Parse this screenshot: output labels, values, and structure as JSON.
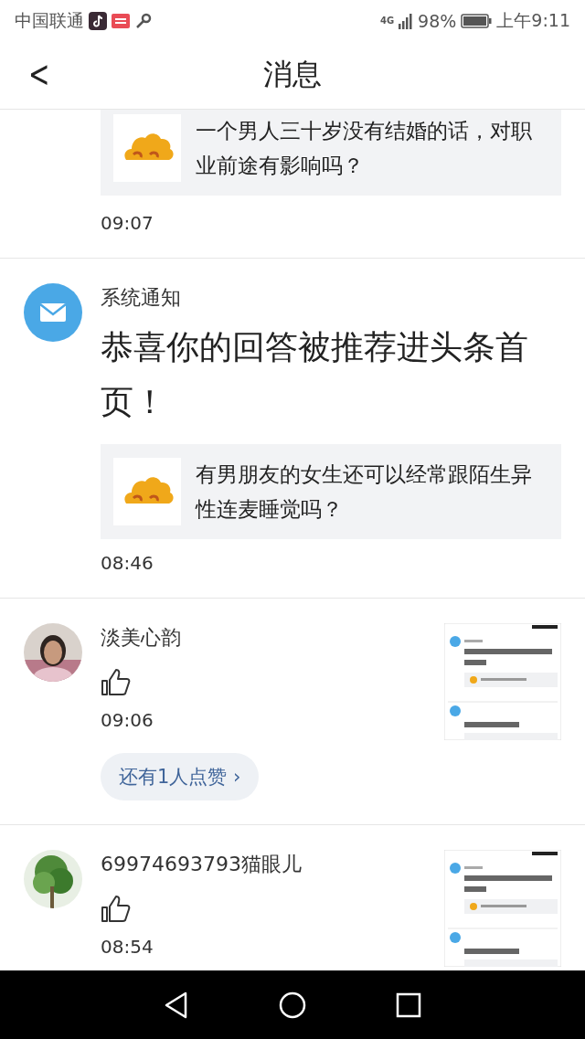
{
  "status_bar": {
    "carrier": "中国联通",
    "network": "4G",
    "battery": "98%",
    "time": "上午9:11"
  },
  "header": {
    "back": "<",
    "title": "消息"
  },
  "messages": [
    {
      "kind": "system",
      "question": "一个男人三十岁没有结婚的话，对职业前途有影响吗？",
      "time": "09:07"
    },
    {
      "kind": "system",
      "sender": "系统通知",
      "text": "恭喜你的回答被推荐进头条首页！",
      "question": "有男朋友的女生还可以经常跟陌生异性连麦睡觉吗？",
      "time": "08:46"
    },
    {
      "kind": "like",
      "sender": "淡美心韵",
      "time": "09:06",
      "more": "还有1人点赞 ›"
    },
    {
      "kind": "like",
      "sender": "69974693793猫眼儿",
      "time": "08:54"
    }
  ]
}
